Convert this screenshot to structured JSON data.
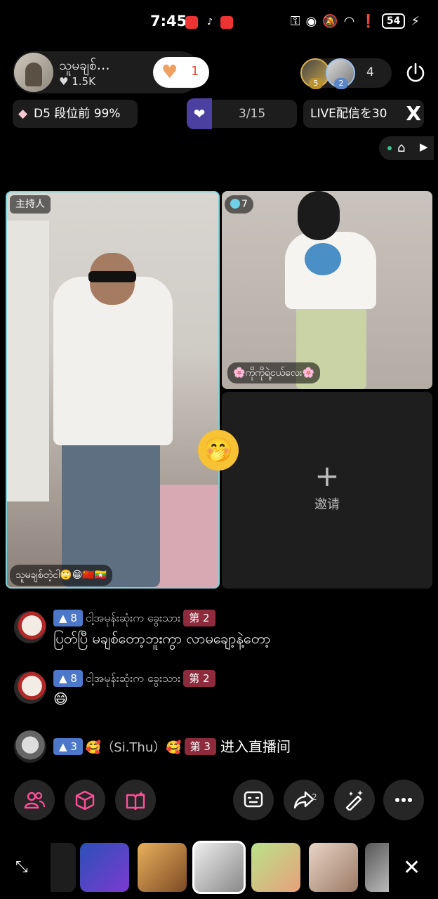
{
  "status_bar": {
    "time": "7:45",
    "battery": "54"
  },
  "host": {
    "name": "သူမချစ်…",
    "likes": "1.5K",
    "follow_count": "1"
  },
  "viewers": {
    "badge1": "5",
    "badge2": "2",
    "count": "4"
  },
  "rank": {
    "text": "D5 段位前 99%"
  },
  "task": {
    "progress": "3/15"
  },
  "live": {
    "text": "LIVE配信を30",
    "close_label": "X"
  },
  "stage": {
    "host_role": "主持人",
    "host_caption": "သူမချစ်တဲ့ငါ🙄😁🇨🇳🇲🇲",
    "guest_level": "7",
    "guest_caption": "🌸ကိုကိုရဲ့ငယ်လေး🌸",
    "invite_plus": "+",
    "invite_label": "邀请"
  },
  "chat": [
    {
      "level": "8",
      "user": "ငါ့အမုန်းဆုံးက ခွေးသား",
      "rank": "第 2",
      "message": "ပြတ်ပြီ မချစ်တော့ဘူးကွာ လာမချော့နဲ့တော့"
    },
    {
      "level": "8",
      "user": "ငါ့အမုန်းဆုံးက ခွေးသား",
      "rank": "第 2",
      "message": "😄"
    },
    {
      "level": "3",
      "user": "🥰（Si.Thu）🥰",
      "rank": "第 3",
      "message": "进入直播间"
    }
  ],
  "toolbar": {
    "share_badge": "2"
  }
}
